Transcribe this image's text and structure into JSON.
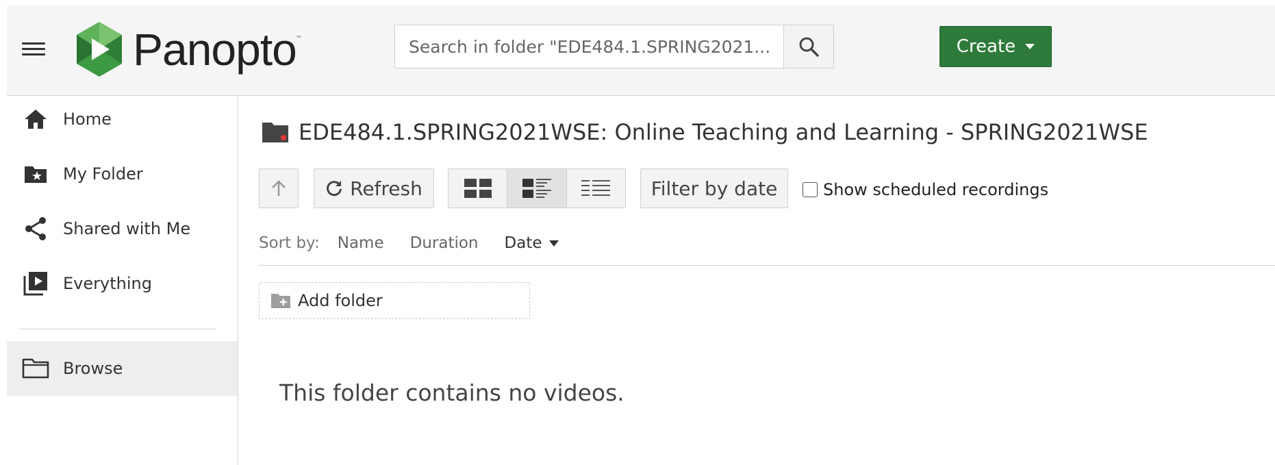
{
  "header": {
    "logo_text": "Panopto",
    "logo_tm": "™",
    "search": {
      "placeholder": "Search in folder \"EDE484.1.SPRING2021...",
      "value": ""
    },
    "create_label": "Create"
  },
  "sidebar": {
    "items": [
      {
        "label": "Home",
        "icon": "home-icon"
      },
      {
        "label": "My Folder",
        "icon": "my-folder-icon"
      },
      {
        "label": "Shared with Me",
        "icon": "share-icon"
      },
      {
        "label": "Everything",
        "icon": "everything-icon"
      },
      {
        "label": "Browse",
        "icon": "folder-icon",
        "active": true
      }
    ]
  },
  "main": {
    "folder_title": "EDE484.1.SPRING2021WSE: Online Teaching and Learning - SPRING2021WSE",
    "toolbar": {
      "refresh_label": "Refresh",
      "filter_label": "Filter by date",
      "show_scheduled_label": "Show scheduled recordings",
      "show_scheduled_checked": false,
      "selected_view": "detail"
    },
    "sort": {
      "label": "Sort by:",
      "options": [
        "Name",
        "Duration",
        "Date"
      ],
      "active": "Date"
    },
    "add_folder_label": "Add folder",
    "empty_message": "This folder contains no videos."
  },
  "colors": {
    "create_green": "#2d7a3a",
    "header_bg": "#f5f5f5",
    "logo_green": "#4caf50"
  }
}
